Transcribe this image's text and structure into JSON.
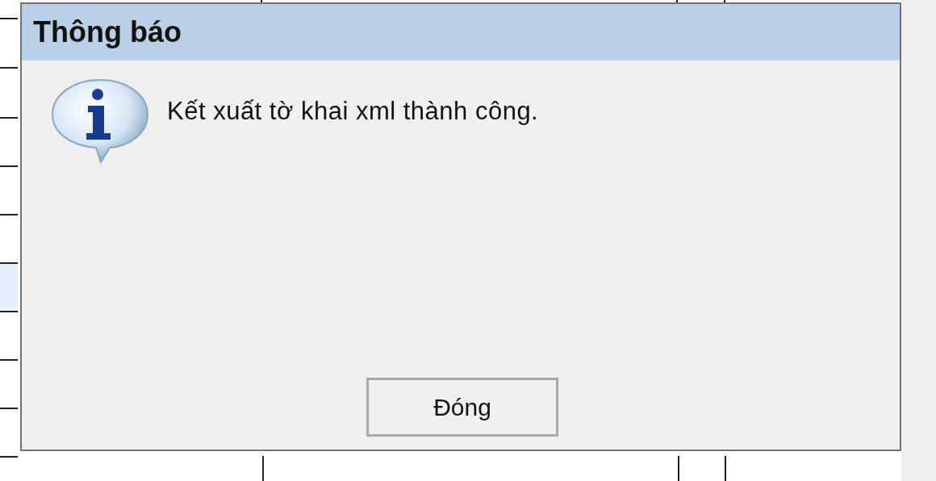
{
  "dialog": {
    "title": "Thông báo",
    "message": "Kết xuất tờ khai xml thành công.",
    "buttons": [
      {
        "label": "Đóng"
      }
    ]
  }
}
